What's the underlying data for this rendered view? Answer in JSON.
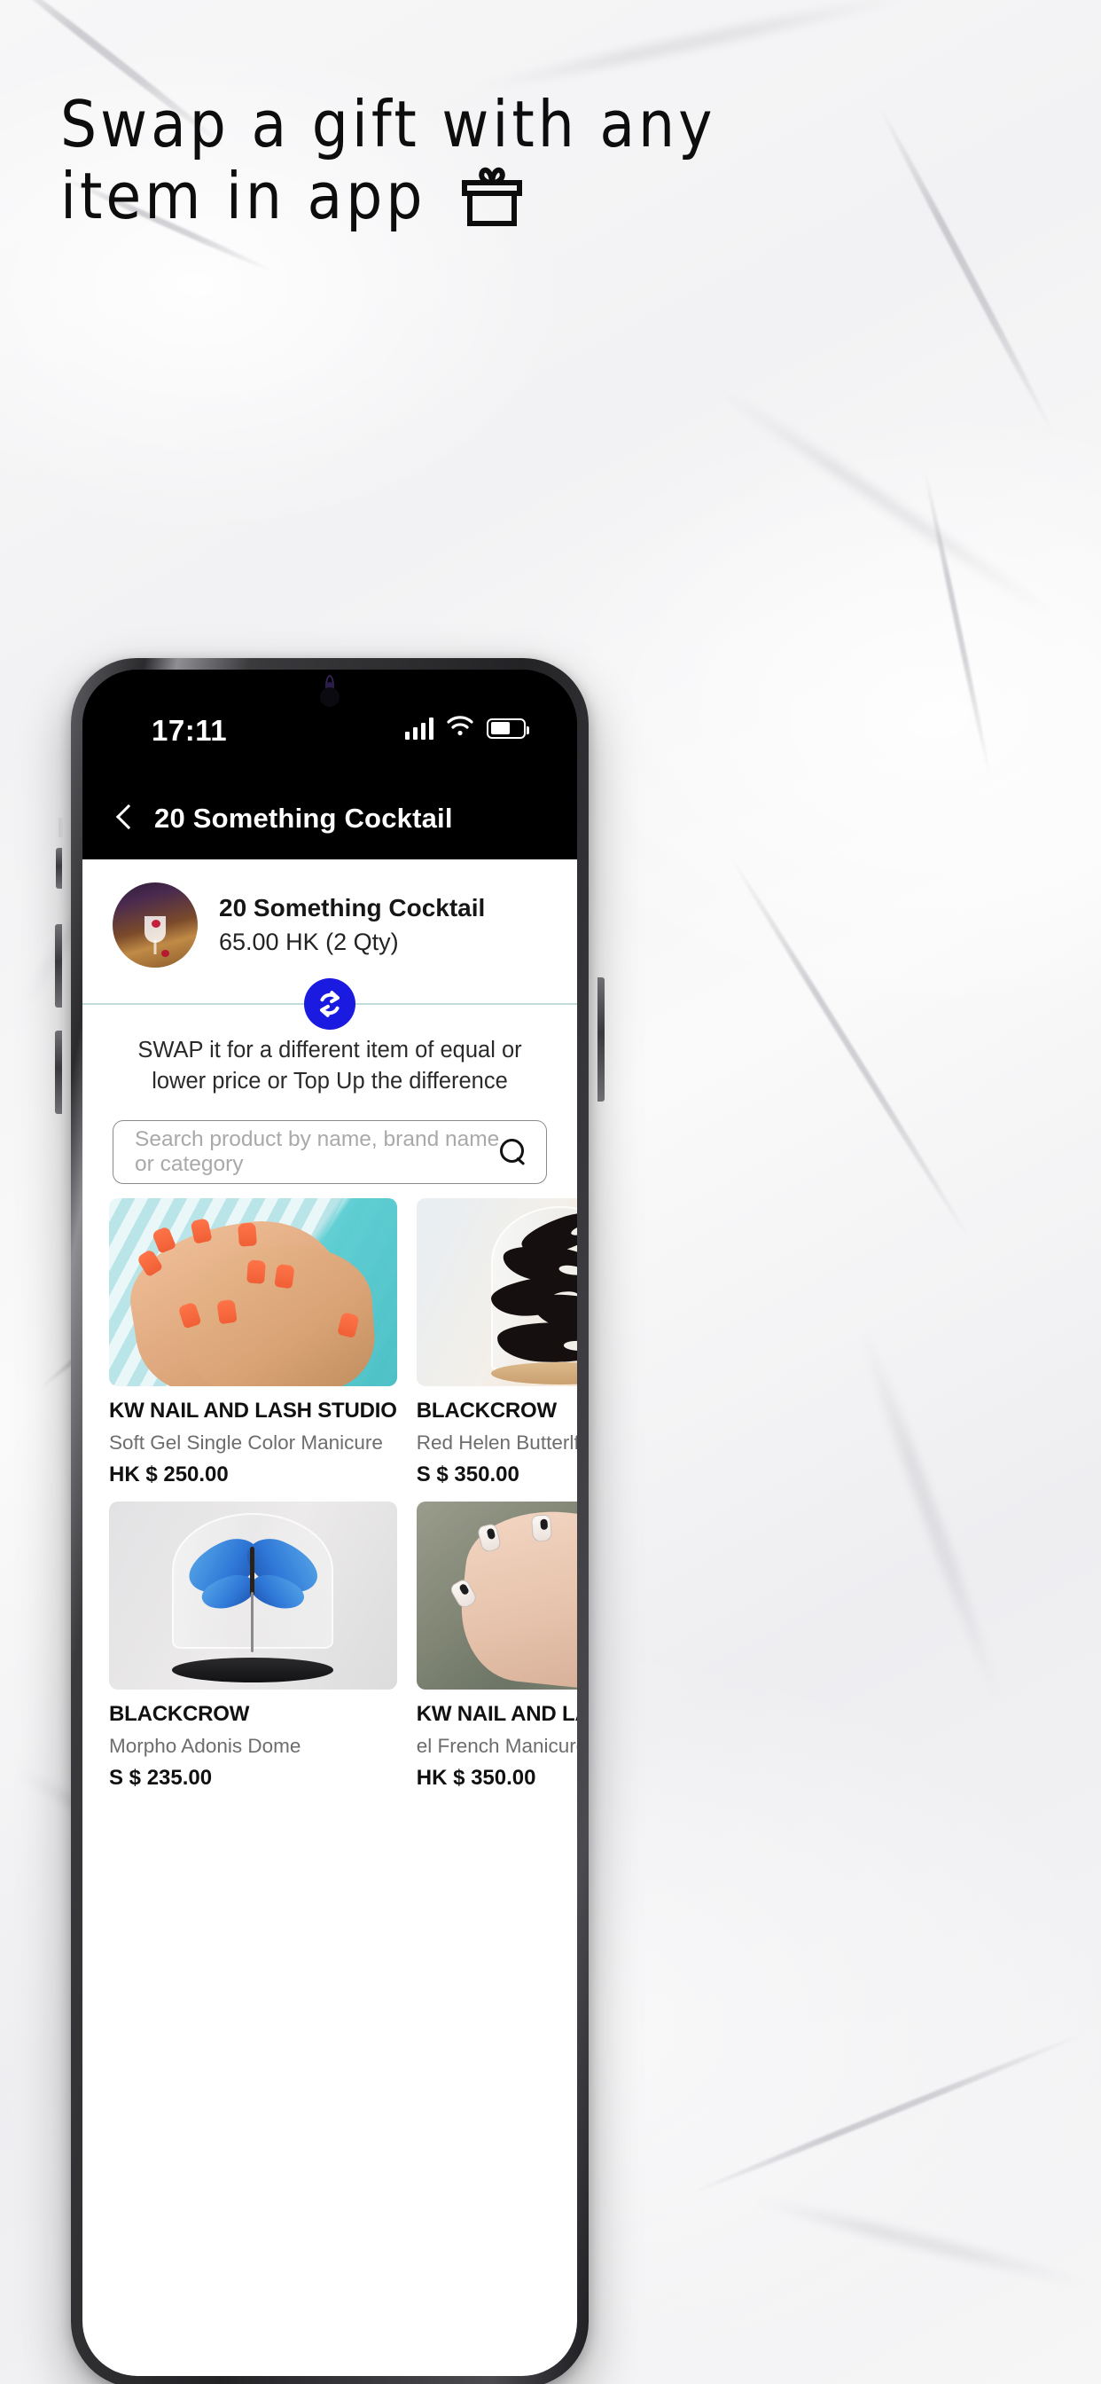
{
  "promo": {
    "line1": "Swap a gift with any",
    "line2": "item in app",
    "gift_icon": "gift-icon"
  },
  "phone": {
    "status_bar": {
      "time": "17:11",
      "signal_icon": "cellular-signal-icon",
      "wifi_icon": "wifi-icon",
      "battery_icon": "battery-icon"
    },
    "app_header": {
      "back_icon": "back-chevron-icon",
      "title": "20 Something Cocktail"
    },
    "item": {
      "thumbnail_icon": "cocktail-thumbnail",
      "name": "20 Something Cocktail",
      "price": "65.00 HK (2 Qty)"
    },
    "swap": {
      "badge_icon": "swap-arrows-icon",
      "badge_color": "#1a1ae0",
      "divider_color": "#bfdcd8",
      "description": "SWAP it for a different item of equal or lower price or Top Up the difference"
    },
    "search": {
      "placeholder": "Search product by name, brand name  or category",
      "value": "",
      "icon": "search-icon"
    },
    "products": [
      {
        "brand": "KW NAIL AND LASH STUDIO",
        "name": "Soft Gel Single Color Manicure",
        "price": "HK $ 250.00",
        "image": "orange-manicure-hands-photo"
      },
      {
        "brand": "BLACKCROW",
        "name": "Red Helen Butterlfy Dome",
        "price": "S $ 350.00",
        "image": "black-butterfly-glass-dome-photo"
      },
      {
        "brand": "BLACKCROW",
        "name": "Morpho Adonis Dome",
        "price": "S $ 235.00",
        "image": "blue-morpho-butterfly-dome-photo"
      },
      {
        "brand": "KW NAIL AND LASH STUDIO",
        "name": "el French Manicure Special",
        "price": "HK $ 350.00",
        "image": "french-manicure-nails-photo"
      }
    ]
  }
}
